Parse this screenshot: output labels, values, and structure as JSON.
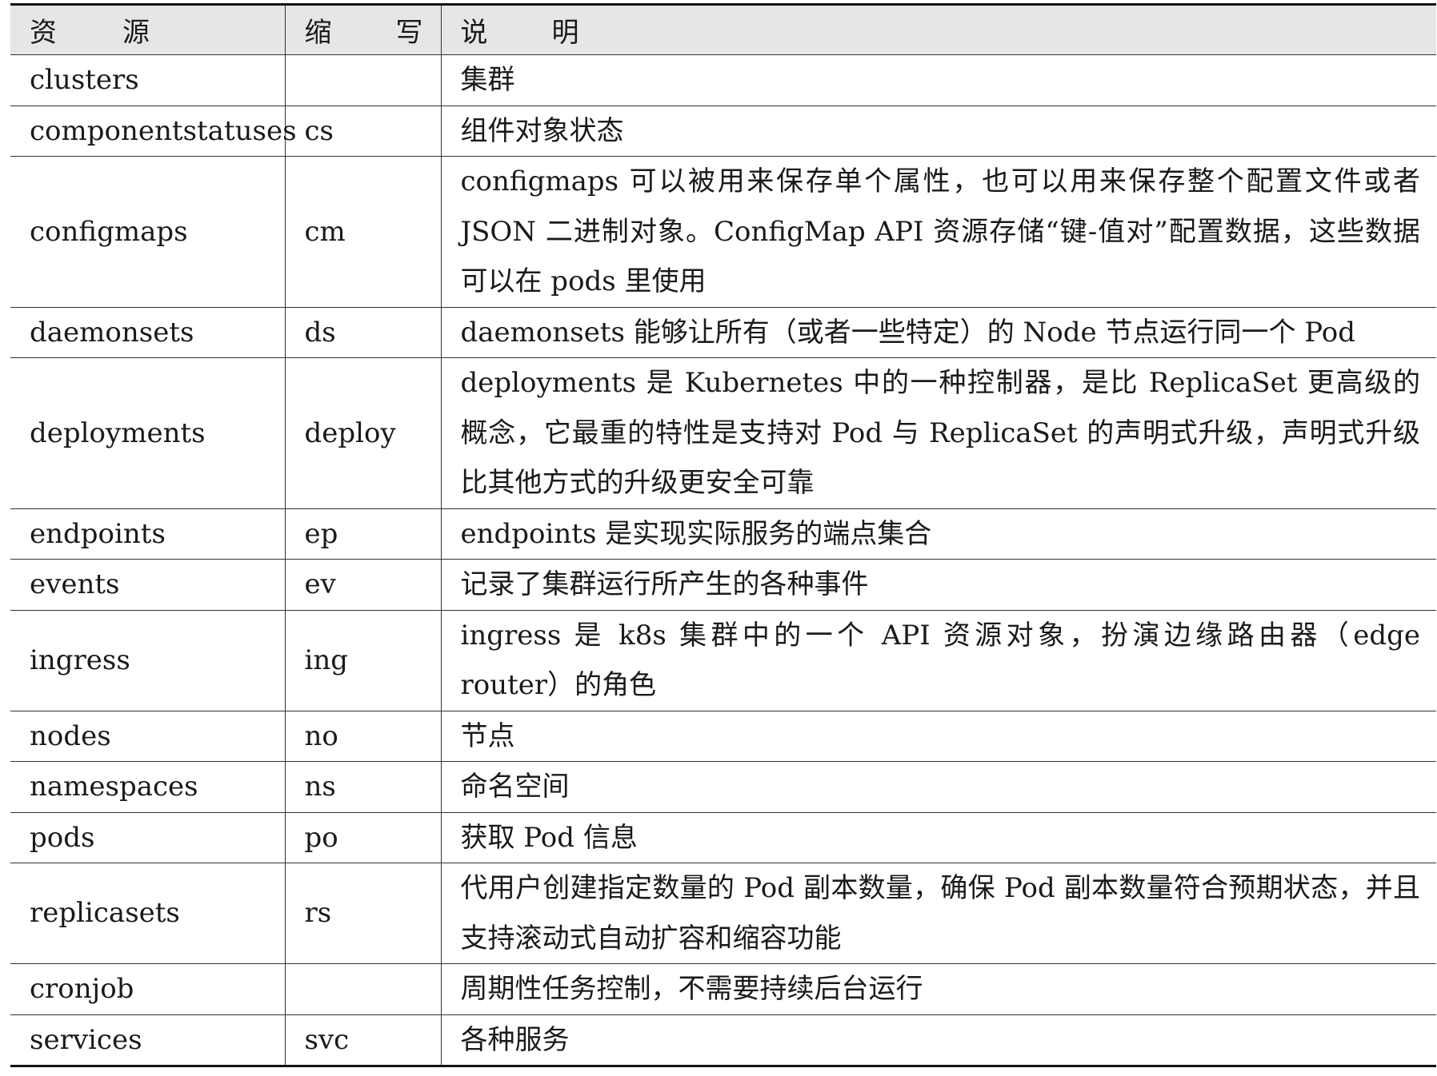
{
  "table": {
    "headers": [
      [
        "资",
        "源"
      ],
      [
        "缩",
        "写"
      ],
      [
        "说",
        "明"
      ]
    ],
    "rows": [
      {
        "resource": "clusters",
        "abbr": "",
        "desc": "集群"
      },
      {
        "resource": "componentstatuses",
        "abbr": "cs",
        "desc": "组件对象状态"
      },
      {
        "resource": "configmaps",
        "abbr": "cm",
        "desc": "configmaps 可以被用来保存单个属性，也可以用来保存整个配置文件或者 JSON 二进制对象。ConfigMap API 资源存储“键-值对”配置数据，这些数据可以在 pods 里使用"
      },
      {
        "resource": "daemonsets",
        "abbr": "ds",
        "desc": "daemonsets 能够让所有（或者一些特定）的 Node 节点运行同一个 Pod"
      },
      {
        "resource": "deployments",
        "abbr": "deploy",
        "desc": "deployments 是 Kubernetes 中的一种控制器，是比 ReplicaSet 更高级的概念，它最重的特性是支持对 Pod 与 ReplicaSet 的声明式升级，声明式升级比其他方式的升级更安全可靠"
      },
      {
        "resource": "endpoints",
        "abbr": "ep",
        "desc": "endpoints 是实现实际服务的端点集合"
      },
      {
        "resource": "events",
        "abbr": "ev",
        "desc": "记录了集群运行所产生的各种事件"
      },
      {
        "resource": "ingress",
        "abbr": "ing",
        "desc": "ingress 是 k8s 集群中的一个 API 资源对象，扮演边缘路由器（edge router）的角色"
      },
      {
        "resource": "nodes",
        "abbr": "no",
        "desc": "节点"
      },
      {
        "resource": "namespaces",
        "abbr": "ns",
        "desc": "命名空间"
      },
      {
        "resource": "pods",
        "abbr": "po",
        "desc": "获取 Pod 信息"
      },
      {
        "resource": "replicasets",
        "abbr": "rs",
        "desc": "代用户创建指定数量的 Pod 副本数量，确保 Pod 副本数量符合预期状态，并且支持滚动式自动扩容和缩容功能"
      },
      {
        "resource": "cronjob",
        "abbr": "",
        "desc": "周期性任务控制，不需要持续后台运行"
      },
      {
        "resource": "services",
        "abbr": "svc",
        "desc": "各种服务"
      }
    ]
  }
}
